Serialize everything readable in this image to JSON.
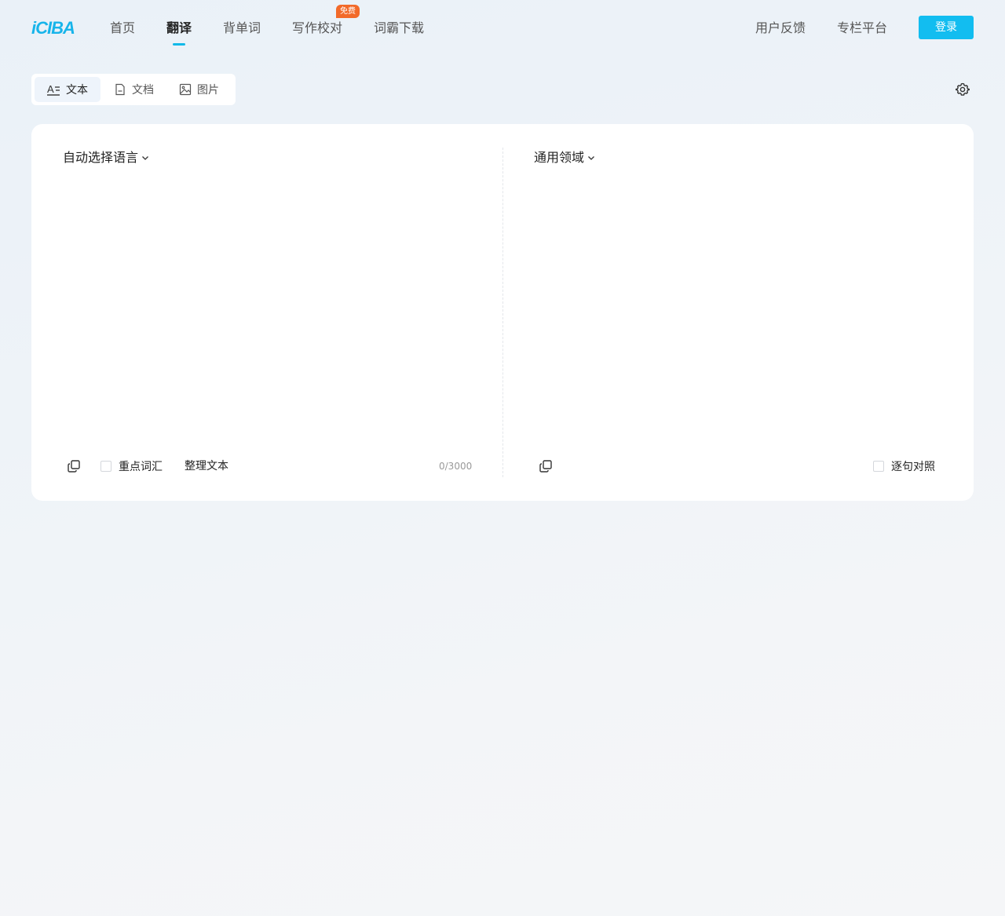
{
  "header": {
    "logo": "iCIBA",
    "nav": [
      {
        "label": "首页"
      },
      {
        "label": "翻译",
        "active": true
      },
      {
        "label": "背单词"
      },
      {
        "label": "写作校对",
        "badge": "免费"
      },
      {
        "label": "词霸下载"
      }
    ],
    "right_links": [
      "用户反馈",
      "专栏平台"
    ],
    "login_label": "登录",
    "accent_color": "#12bdf0",
    "badge_color": "#f26a2a"
  },
  "mode_tabs": [
    {
      "label": "文本",
      "icon": "text-format-icon",
      "active": true
    },
    {
      "label": "文档",
      "icon": "document-icon"
    },
    {
      "label": "图片",
      "icon": "image-icon"
    }
  ],
  "settings_icon": "gear-icon",
  "source": {
    "language_label": "自动选择语言",
    "text_value": "",
    "key_vocab_label": "重点词汇",
    "key_vocab_checked": false,
    "tidy_label": "整理文本",
    "counter": "0/3000"
  },
  "target": {
    "domain_label": "通用领域",
    "sentence_compare_label": "逐句对照",
    "sentence_compare_checked": false
  }
}
